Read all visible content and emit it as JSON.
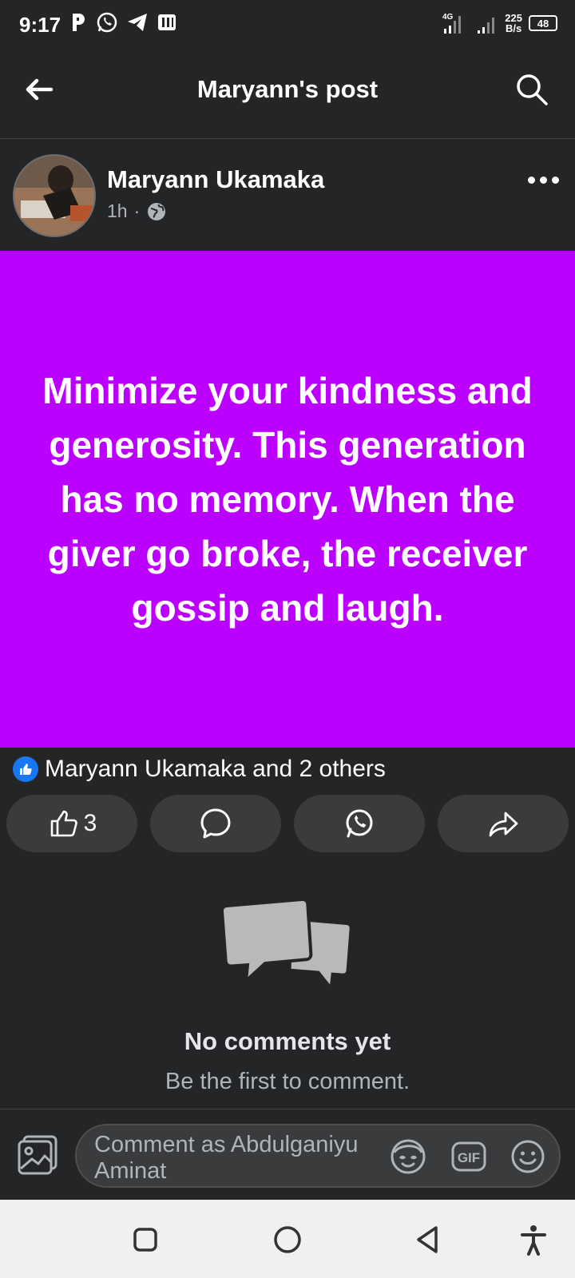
{
  "status_bar": {
    "time": "9:17",
    "network": "4G",
    "speed_value": "225",
    "speed_unit": "B/s",
    "battery": "48"
  },
  "header": {
    "title": "Maryann's post"
  },
  "post": {
    "author": "Maryann Ukamaka",
    "time_ago": "1h",
    "separator": "·",
    "audience_icon": "globe-icon",
    "background_color": "#bb00ff",
    "text": "Minimize your kindness and generosity. This generation has no memory. When the giver go broke, the receiver gossip and laugh."
  },
  "reactions": {
    "summary": "Maryann Ukamaka and 2 others",
    "like_count": "3"
  },
  "comments": {
    "empty_title": "No comments yet",
    "empty_subtitle": "Be the first to comment."
  },
  "composer": {
    "placeholder": "Comment as Abdulganiyu Aminat",
    "gif_label": "GIF"
  },
  "colors": {
    "background": "#242526",
    "accent_blue": "#1877f2",
    "button_bg": "#3a3b3c"
  }
}
